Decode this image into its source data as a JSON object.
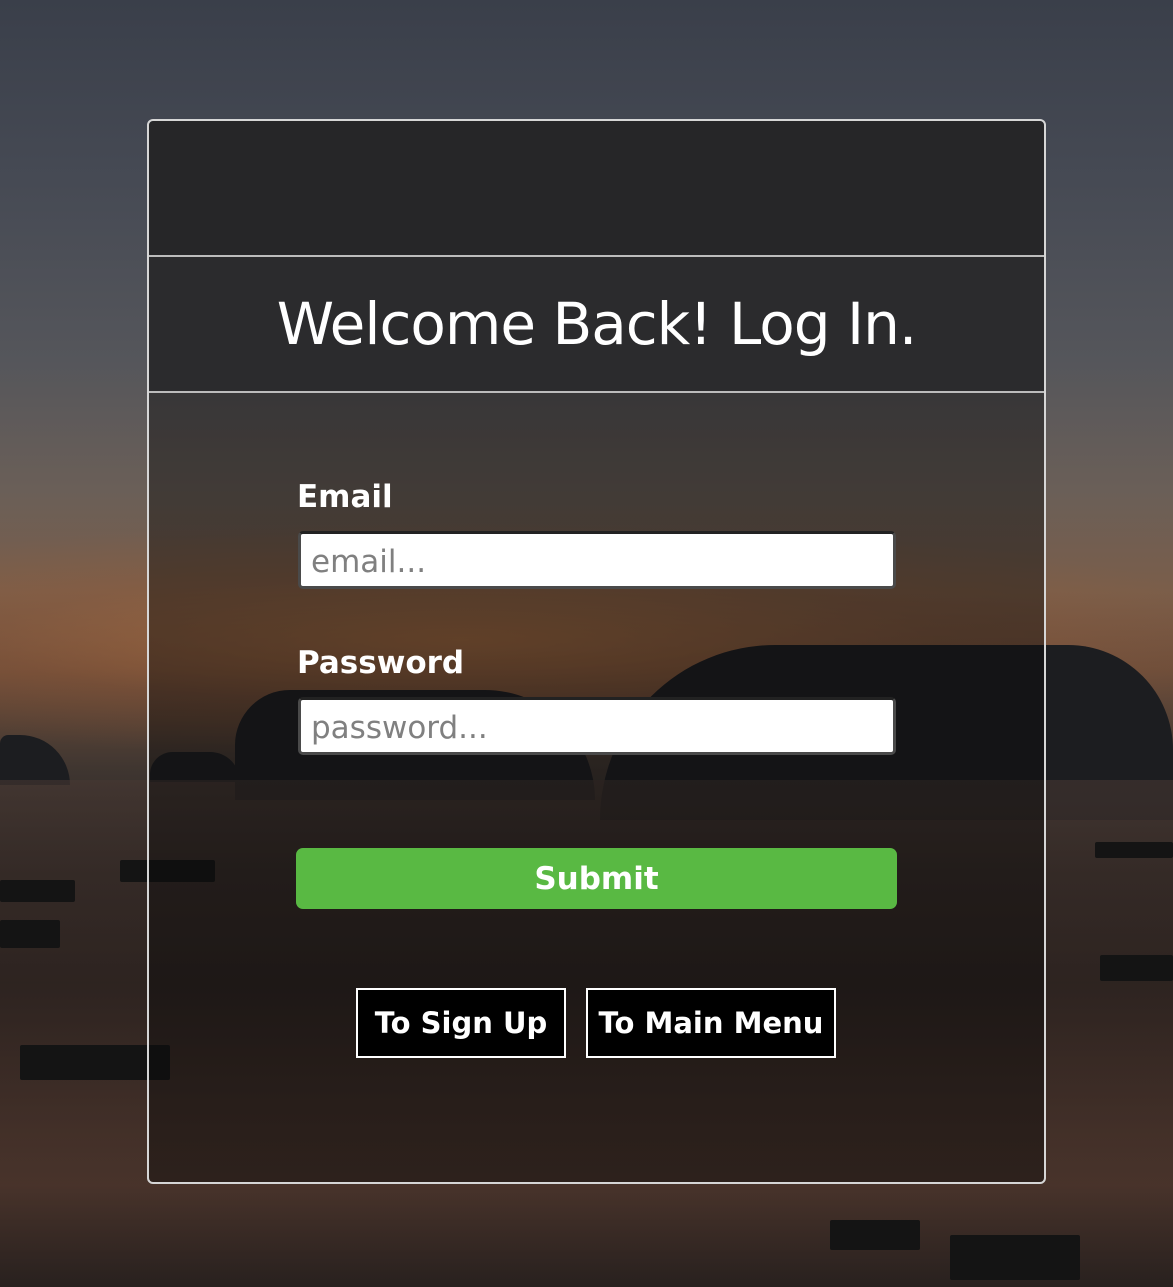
{
  "login": {
    "title": "Welcome Back! Log In.",
    "email": {
      "label": "Email",
      "placeholder": "email...",
      "value": ""
    },
    "password": {
      "label": "Password",
      "placeholder": "password...",
      "value": ""
    },
    "submit_label": "Submit",
    "sign_up_label": "To Sign Up",
    "main_menu_label": "To Main Menu"
  },
  "colors": {
    "submit_button": "#59b943",
    "panel_border": "#d6d6d6",
    "panel_header": "#262628"
  }
}
